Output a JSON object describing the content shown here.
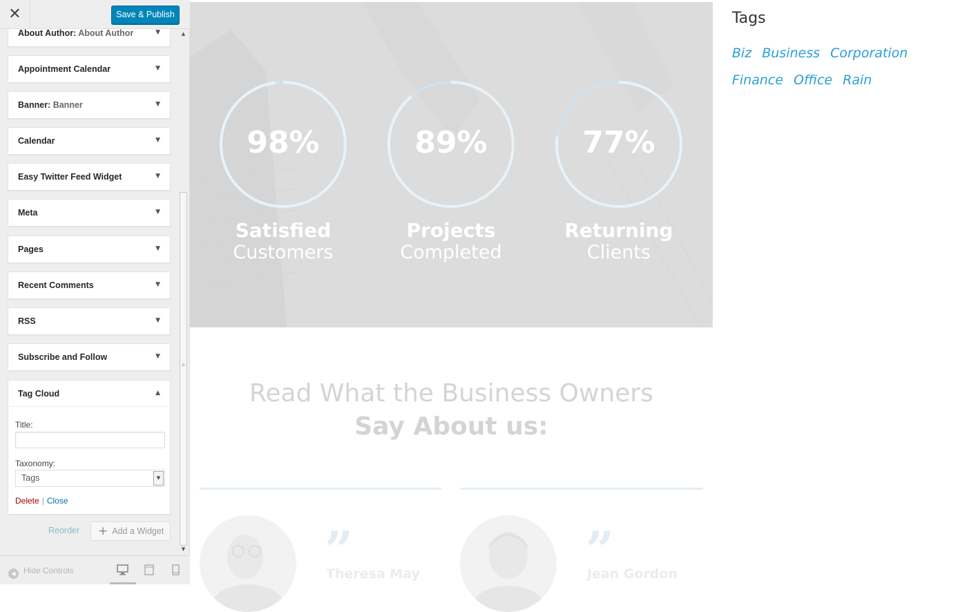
{
  "header": {
    "close_icon": "close-icon",
    "save_label": "Save & Publish",
    "save_color": "#0085ba"
  },
  "widgets": [
    {
      "label": "About Author:",
      "sub": " About Author"
    },
    {
      "label": "Appointment Calendar",
      "sub": ""
    },
    {
      "label": "Banner:",
      "sub": " Banner"
    },
    {
      "label": "Calendar",
      "sub": ""
    },
    {
      "label": "Easy Twitter Feed Widget",
      "sub": ""
    },
    {
      "label": "Meta",
      "sub": ""
    },
    {
      "label": "Pages",
      "sub": ""
    },
    {
      "label": "Recent Comments",
      "sub": ""
    },
    {
      "label": "RSS",
      "sub": ""
    },
    {
      "label": "Subscribe and Follow",
      "sub": ""
    }
  ],
  "tag_cloud_widget": {
    "label": "Tag Cloud",
    "title_label": "Title:",
    "title_value": "",
    "taxonomy_label": "Taxonomy:",
    "taxonomy_value": "Tags",
    "delete_label": "Delete",
    "separator": "|",
    "close_label": "Close"
  },
  "panel_actions": {
    "reorder_label": "Reorder",
    "add_widget_label": "Add a Widget"
  },
  "footer": {
    "hide_controls_label": "Hide Controls",
    "devices": [
      "desktop",
      "tablet",
      "mobile"
    ],
    "active_device": "desktop"
  },
  "stats": [
    {
      "value": "98%",
      "line1": "Satisfied",
      "line2": "Customers",
      "percent": 98
    },
    {
      "value": "89%",
      "line1": "Projects",
      "line2": "Completed",
      "percent": 89
    },
    {
      "value": "77%",
      "line1": "Returning",
      "line2": "Clients",
      "percent": 77
    }
  ],
  "testimonials": {
    "heading_line1": "Read What the Business Owners",
    "heading_line2": "Say About us:",
    "items": [
      {
        "name": "Theresa May"
      },
      {
        "name": "Jean Gordon"
      }
    ]
  },
  "tags_widget": {
    "title": "Tags",
    "tags": [
      "Biz",
      "Business",
      "Corporation",
      "Finance",
      "Office",
      "Rain"
    ],
    "tag_color": "#2a9fd6"
  }
}
